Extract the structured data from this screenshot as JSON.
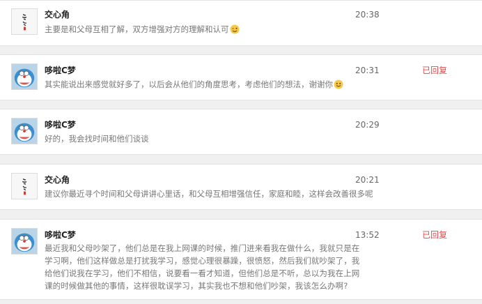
{
  "messages": [
    {
      "name": "交心角",
      "time": "20:38",
      "status": "",
      "text": "主要是和父母互相了解，双方增强对方的理解和认可",
      "emoji_icon": "wink-face-icon",
      "avatar_icon": "calligraphy-seal-avatar-icon"
    },
    {
      "name": "哆啦C梦",
      "time": "20:31",
      "status": "已回复",
      "text": "其实能说出来感觉就好多了，以后会从他们的角度思考，考虑他们的想法，谢谢你",
      "emoji_icon": "smile-face-icon",
      "avatar_icon": "doraemon-avatar-icon"
    },
    {
      "name": "哆啦C梦",
      "time": "20:29",
      "status": "",
      "text": "好的，我会找时间和他们谈谈",
      "emoji_icon": "",
      "avatar_icon": "doraemon-avatar-icon"
    },
    {
      "name": "交心角",
      "time": "20:21",
      "status": "",
      "text": "建议你最近寻个时间和父母讲讲心里话，和父母互相增强信任，家庭和睦，这样会改善很多呢",
      "emoji_icon": "",
      "avatar_icon": "calligraphy-seal-avatar-icon"
    },
    {
      "name": "哆啦C梦",
      "time": "13:52",
      "status": "已回复",
      "text": "最近我和父母吵架了，他们总是在我上网课的时候，推门进来看我在做什么，我就只是在学习啊，他们这样做总是打扰我学习，感觉心理很暴躁，很愤怒，然后我们就吵架了，我给他们说我在学习，他们不相信，说要看一看才知道，但他们总是不听，总以为我在上网课的时候做其他的事情，这样很耽误学习，其实我也不想和他们吵架，我该怎么办啊?",
      "emoji_icon": "",
      "avatar_icon": "doraemon-avatar-icon"
    }
  ]
}
